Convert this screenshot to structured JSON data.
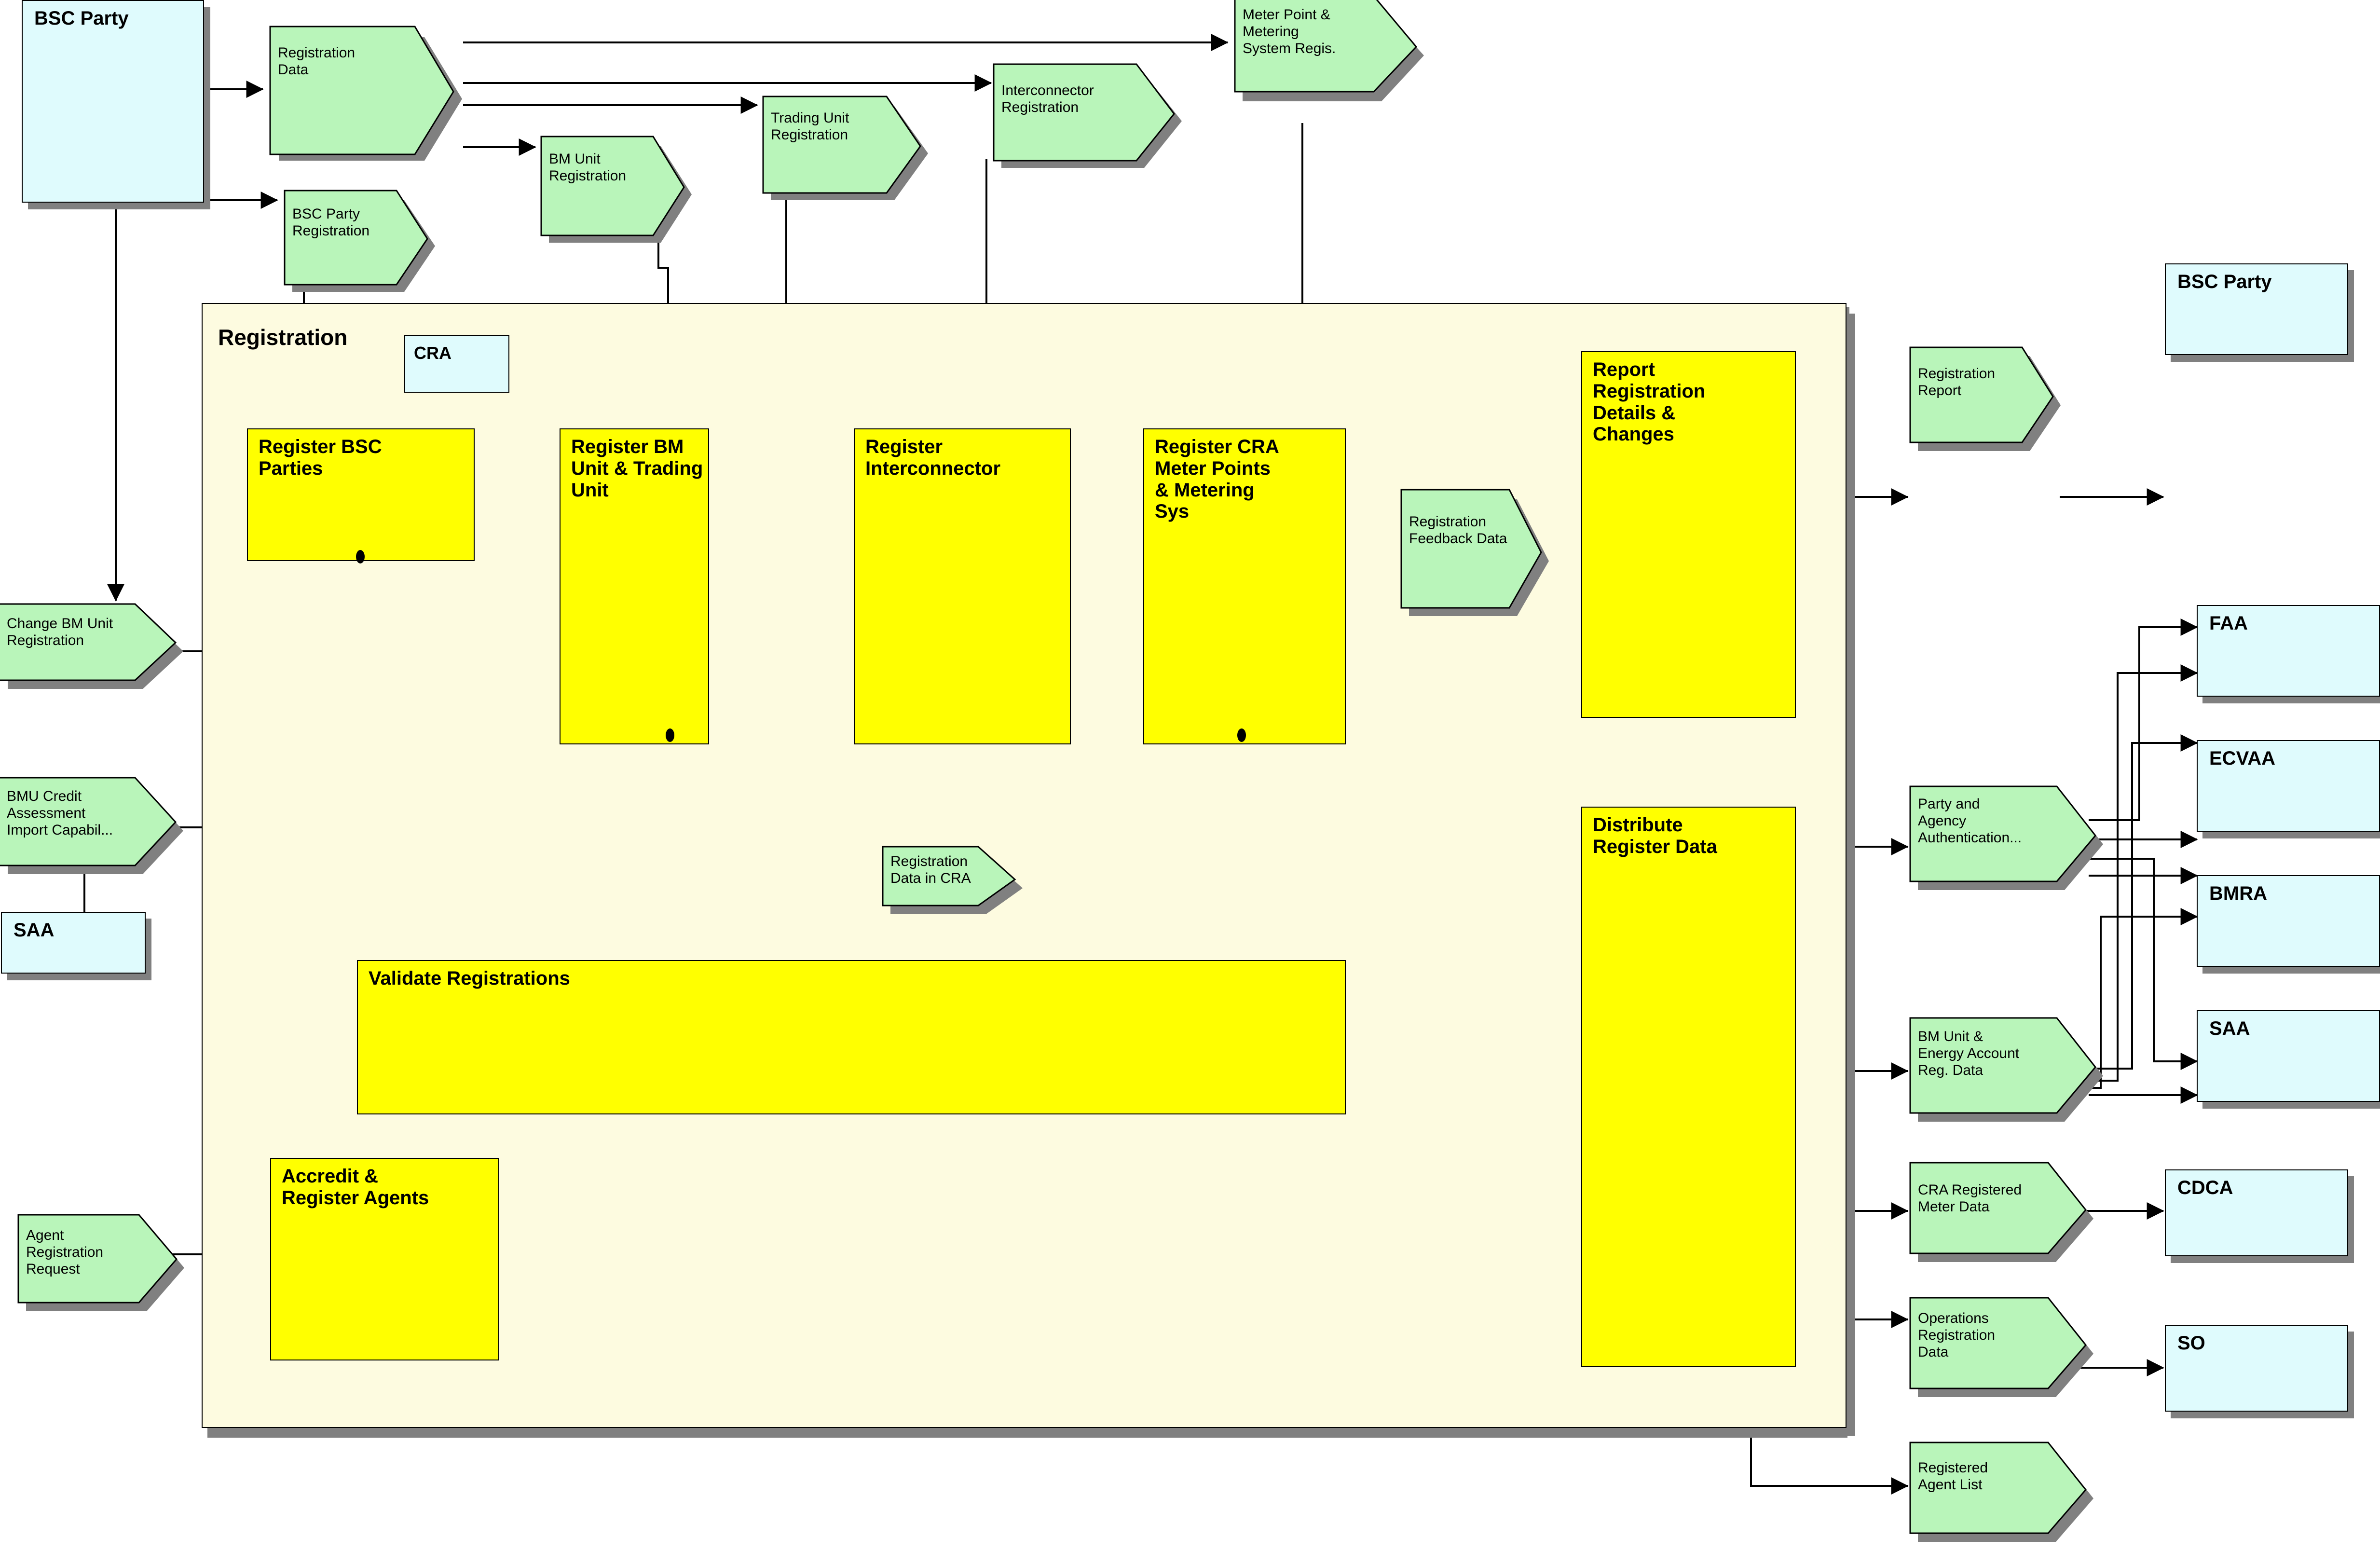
{
  "diagram": {
    "title": "Registration",
    "type": "data-flow-diagram",
    "colors": {
      "process_fill": "#ffff00",
      "flow_fill": "#b9f5ba",
      "entity_fill": "#dffbfd",
      "container_fill": "#fdfbe0",
      "shadow": "#808080",
      "line": "#000000"
    }
  },
  "container": {
    "label": "Registration"
  },
  "entities": [
    {
      "id": "bsc-party-left",
      "label": "BSC Party"
    },
    {
      "id": "cra",
      "label": "CRA"
    },
    {
      "id": "saa-left",
      "label": "SAA"
    },
    {
      "id": "bsc-party-right",
      "label": "BSC Party"
    },
    {
      "id": "faa",
      "label": "FAA"
    },
    {
      "id": "ecvaa",
      "label": "ECVAA"
    },
    {
      "id": "bmra",
      "label": "BMRA"
    },
    {
      "id": "saa-right",
      "label": "SAA"
    },
    {
      "id": "cdca",
      "label": "CDCA"
    },
    {
      "id": "so",
      "label": "SO"
    }
  ],
  "processes": [
    {
      "id": "register-bsc-parties",
      "label": "Register BSC\nParties"
    },
    {
      "id": "register-bm-unit",
      "label": "Register BM\nUnit & Trading\nUnit"
    },
    {
      "id": "register-interconnector",
      "label": "Register\nInterconnector"
    },
    {
      "id": "register-cra-meter",
      "label": "Register CRA\nMeter Points\n& Metering\nSys"
    },
    {
      "id": "report-registration",
      "label": "Report\nRegistration\nDetails &\nChanges"
    },
    {
      "id": "distribute-register",
      "label": "Distribute\nRegister Data"
    },
    {
      "id": "validate-registrations",
      "label": "Validate Registrations"
    },
    {
      "id": "accredit-register",
      "label": "Accredit &\nRegister Agents"
    }
  ],
  "flows": [
    {
      "id": "registration-data",
      "label": "Registration\nData"
    },
    {
      "id": "bsc-party-registration",
      "label": "BSC Party\nRegistration"
    },
    {
      "id": "bm-unit-registration",
      "label": "BM Unit\nRegistration"
    },
    {
      "id": "trading-unit-registration",
      "label": "Trading Unit\nRegistration"
    },
    {
      "id": "interconnector-registration",
      "label": "Interconnector\nRegistration"
    },
    {
      "id": "meter-point-metering",
      "label": "Meter Point &\nMetering\nSystem Regis."
    },
    {
      "id": "change-bm-unit-reg",
      "label": "Change BM Unit\nRegistration"
    },
    {
      "id": "bmu-credit-assessment",
      "label": "BMU Credit\nAssessment\nImport Capabil..."
    },
    {
      "id": "agent-registration-request",
      "label": "Agent\nRegistration\nRequest"
    },
    {
      "id": "registration-feedback",
      "label": "Registration\nFeedback Data"
    },
    {
      "id": "registration-data-in-cra",
      "label": "Registration\nData in CRA"
    },
    {
      "id": "registration-report",
      "label": "Registration\nReport"
    },
    {
      "id": "party-agency-auth",
      "label": "Party and\nAgency\nAuthentication..."
    },
    {
      "id": "bm-unit-energy-account",
      "label": "BM Unit &\nEnergy Account\nReg. Data"
    },
    {
      "id": "cra-registered-meter",
      "label": "CRA Registered\nMeter Data"
    },
    {
      "id": "operations-registration",
      "label": "Operations\nRegistration\nData"
    },
    {
      "id": "registered-agent-list",
      "label": "Registered\nAgent List"
    }
  ]
}
